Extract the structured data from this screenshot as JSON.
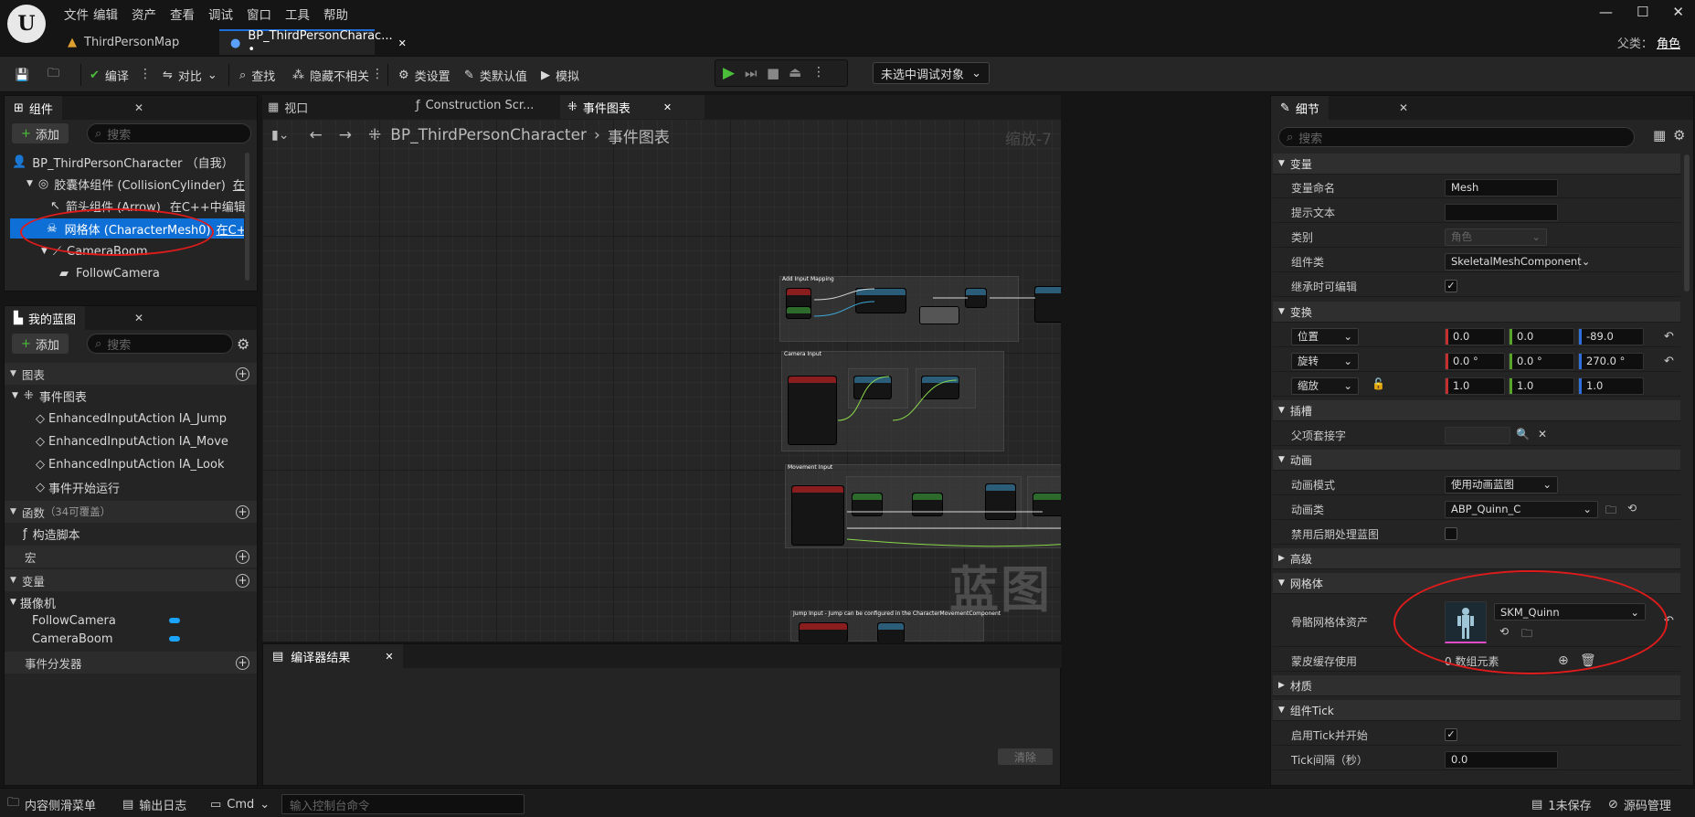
{
  "menu": [
    "文件",
    "编辑",
    "资产",
    "查看",
    "调试",
    "窗口",
    "工具",
    "帮助"
  ],
  "tabs": {
    "map": "ThirdPersonMap",
    "bp": "BP_ThirdPersonCharac... •"
  },
  "parent": {
    "label": "父类：",
    "value": "角色"
  },
  "toolbar": {
    "compile": "编译",
    "diff": "对比",
    "find": "查找",
    "hide": "隐藏不相关",
    "class_settings": "类设置",
    "class_defaults": "类默认值",
    "simulate": "模拟",
    "debug_target": "未选中调试对象"
  },
  "components": {
    "title": "组件",
    "add": "添加",
    "search_placeholder": "搜索",
    "items": [
      "BP_ThirdPersonCharacter （自我）",
      "胶囊体组件 (CollisionCylinder)",
      "在C",
      "箭头组件 (Arrow)",
      "在C++中编辑",
      "网格体 (CharacterMesh0)",
      "在C++",
      "CameraBoom",
      "FollowCamera"
    ]
  },
  "my_blueprint": {
    "title": "我的蓝图",
    "add": "添加",
    "search_placeholder": "搜索",
    "graphs": "图表",
    "event_graph": "事件图表",
    "events": [
      "EnhancedInputAction IA_Jump",
      "EnhancedInputAction IA_Move",
      "EnhancedInputAction IA_Look",
      "事件开始运行"
    ],
    "functions": "函数",
    "functions_note": "（34可覆盖）",
    "construction": "构造脚本",
    "macros": "宏",
    "variables": "变量",
    "cameras": "摄像机",
    "vars": [
      "FollowCamera",
      "CameraBoom"
    ],
    "dispatchers": "事件分发器"
  },
  "editor_tabs": {
    "viewport": "视口",
    "construction": "Construction Scr...",
    "event_graph": "事件图表"
  },
  "graph": {
    "path": "BP_ThirdPersonCharacter",
    "sub": "事件图表",
    "zoom": "缩放-7",
    "watermark": "蓝图",
    "comments": [
      "Add Input Mapping",
      "Camera Input",
      "Movement Input",
      "Jump Input - Jump can be configured in the CharacterMovementComponent"
    ]
  },
  "compiler": {
    "title": "编译器结果",
    "clear": "清除"
  },
  "details": {
    "title": "细节",
    "search_placeholder": "搜索",
    "cat_variable": "变量",
    "var_name_lbl": "变量命名",
    "var_name": "Mesh",
    "tooltip_lbl": "提示文本",
    "category_lbl": "类别",
    "category": "角色",
    "comp_class_lbl": "组件类",
    "comp_class": "SkeletalMeshComponent",
    "editable_lbl": "继承时可编辑",
    "cat_transform": "变换",
    "loc_lbl": "位置",
    "rot_lbl": "旋转",
    "scale_lbl": "缩放",
    "loc": [
      "0.0",
      "0.0",
      "-89.0"
    ],
    "rot": [
      "0.0 °",
      "0.0 °",
      "270.0 °"
    ],
    "scale": [
      "1.0",
      "1.0",
      "1.0"
    ],
    "cat_socket": "插槽",
    "parent_socket_lbl": "父项套接字",
    "cat_anim": "动画",
    "anim_mode_lbl": "动画模式",
    "anim_mode": "使用动画蓝图",
    "anim_class_lbl": "动画类",
    "anim_class": "ABP_Quinn_C",
    "disable_post_lbl": "禁用后期处理蓝图",
    "cat_advanced": "高级",
    "cat_mesh": "网格体",
    "skel_mesh_lbl": "骨骼网格体资产",
    "skel_mesh": "SKM_Quinn",
    "skin_cache_lbl": "蒙皮缓存使用",
    "skin_cache": "0 数组元素",
    "cat_material": "材质",
    "cat_tick": "组件Tick",
    "tick_start_lbl": "启用Tick并开始",
    "tick_interval_lbl": "Tick间隔（秒）",
    "tick_interval": "0.0"
  },
  "status": {
    "drawer": "内容侧滑菜单",
    "log": "输出日志",
    "cmd": "Cmd",
    "cmd_placeholder": "输入控制台命令",
    "unsaved": "1未保存",
    "source": "源码管理"
  },
  "colors": {
    "accent": "#1e6fd9",
    "selection": "#0e6fd6",
    "annotation": "#e01b1b",
    "play": "#4bbf3a"
  }
}
